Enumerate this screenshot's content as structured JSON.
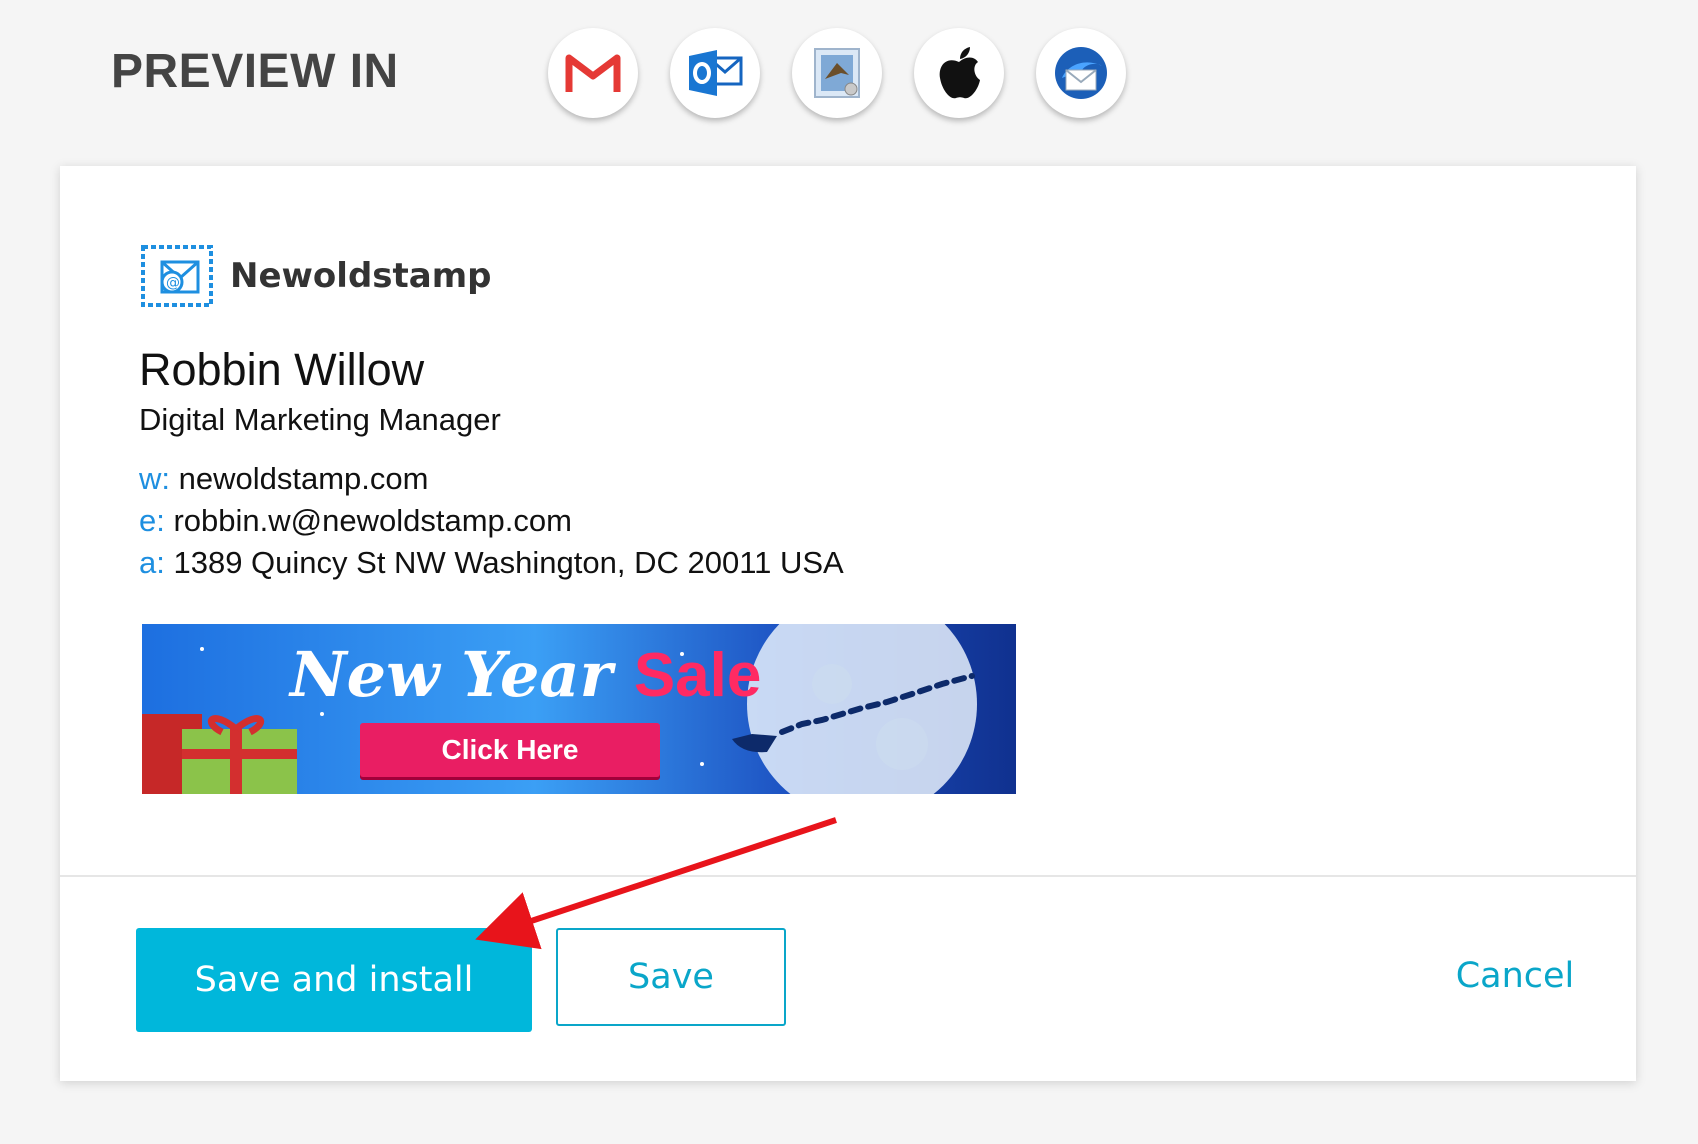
{
  "header": {
    "preview_label": "PREVIEW IN",
    "clients": [
      {
        "name": "Gmail",
        "icon": "gmail-icon"
      },
      {
        "name": "Outlook",
        "icon": "outlook-icon"
      },
      {
        "name": "Apple Mail",
        "icon": "apple-mail-icon"
      },
      {
        "name": "Apple",
        "icon": "apple-icon"
      },
      {
        "name": "Thunderbird",
        "icon": "thunderbird-icon"
      }
    ]
  },
  "signature": {
    "brand": "Newoldstamp",
    "name": "Robbin Willow",
    "job_title": "Digital Marketing Manager",
    "website_key": "w:",
    "website": "newoldstamp.com",
    "email_key": "e:",
    "email": "robbin.w@newoldstamp.com",
    "address_key": "a:",
    "address": "1389 Quincy St NW Washington, DC 20011 USA",
    "banner": {
      "title_part1": "New Year",
      "title_part2": "Sale",
      "cta": "Click Here"
    }
  },
  "actions": {
    "save_install_label": "Save and install",
    "save_label": "Save",
    "cancel_label": "Cancel"
  },
  "colors": {
    "accent": "#00b7db",
    "link_key": "#1e8fe0",
    "annotation_arrow": "#e8141b"
  }
}
